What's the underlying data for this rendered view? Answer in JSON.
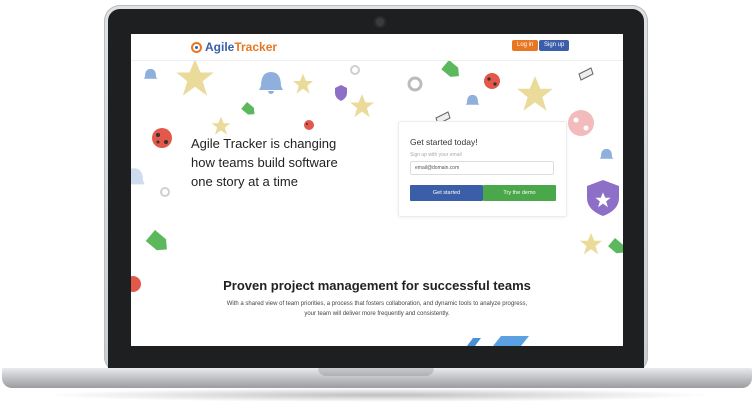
{
  "nav": {
    "logo_part1": "Agile",
    "logo_part2": "Tracker",
    "login_label": "Log in",
    "signup_label": "Sign up"
  },
  "hero": {
    "line1": "Agile Tracker is changing",
    "line2": "how teams build software",
    "line3": "one story at a time"
  },
  "signup_card": {
    "title": "Get started today!",
    "subtitle": "Sign up with your email",
    "email_value": "email@domain.com",
    "start_label": "Get started",
    "demo_label": "Try the demo"
  },
  "section": {
    "title": "Proven project management for successful teams",
    "text": "With a shared view of team priorities, a process that fosters collaboration, and dynamic tools to analyze progress, your team will deliver more frequently and consistently."
  },
  "colors": {
    "brand_blue": "#3b5ea8",
    "brand_orange": "#e87722",
    "demo_green": "#4aa84a",
    "star": "#eadb9a",
    "bell": "#8fb0dd",
    "tag": "#5cb85c",
    "ladybug": "#e2584a",
    "gear": "#b8b8b8"
  },
  "icons": [
    "star-icon",
    "bell-icon",
    "tag-icon",
    "ladybug-icon",
    "gear-icon",
    "flag-icon",
    "badge-icon",
    "camera-icon"
  ]
}
